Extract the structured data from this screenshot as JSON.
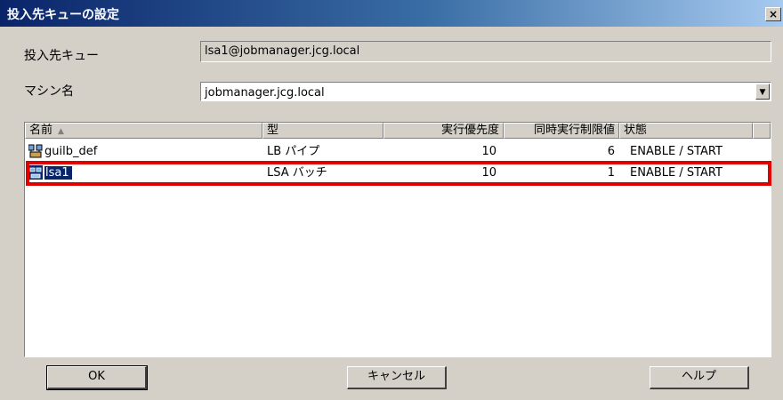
{
  "window": {
    "title": "投入先キューの設定",
    "close_glyph": "×"
  },
  "form": {
    "queue_label": "投入先キュー",
    "queue_value": "lsa1@jobmanager.jcg.local",
    "machine_label": "マシン名",
    "machine_value": "jobmanager.jcg.local"
  },
  "table": {
    "columns": [
      "名前",
      "型",
      "実行優先度",
      "同時実行制限値",
      "状態"
    ],
    "sort_indicator": "▲",
    "rows": [
      {
        "name": "guilb_def",
        "type": "LB パイプ",
        "priority": "10",
        "limit": "6",
        "status": "ENABLE / START",
        "icon": "lb-pipe-icon",
        "selected": false
      },
      {
        "name": "lsa1",
        "type": "LSA バッチ",
        "priority": "10",
        "limit": "1",
        "status": "ENABLE / START",
        "icon": "lsa-batch-icon",
        "selected": true
      }
    ]
  },
  "buttons": {
    "ok": "OK",
    "cancel": "キャンセル",
    "help": "ヘルプ"
  },
  "colors": {
    "highlight_border": "#e00000",
    "selection": "#0a246a",
    "dialog_bg": "#d4d0c8"
  }
}
